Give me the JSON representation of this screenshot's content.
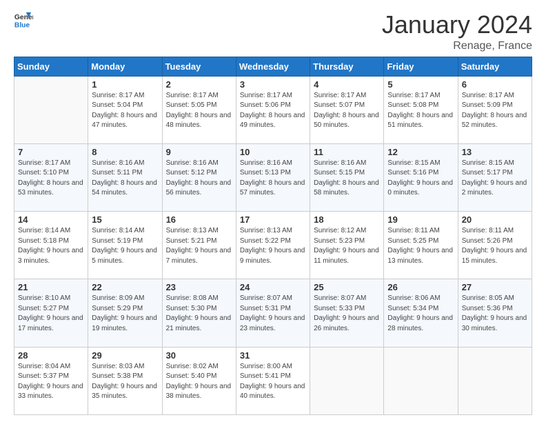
{
  "logo": {
    "line1": "General",
    "line2": "Blue"
  },
  "header": {
    "month": "January 2024",
    "location": "Renage, France"
  },
  "weekdays": [
    "Sunday",
    "Monday",
    "Tuesday",
    "Wednesday",
    "Thursday",
    "Friday",
    "Saturday"
  ],
  "weeks": [
    [
      {
        "day": "",
        "sunrise": "",
        "sunset": "",
        "daylight": ""
      },
      {
        "day": "1",
        "sunrise": "Sunrise: 8:17 AM",
        "sunset": "Sunset: 5:04 PM",
        "daylight": "Daylight: 8 hours and 47 minutes."
      },
      {
        "day": "2",
        "sunrise": "Sunrise: 8:17 AM",
        "sunset": "Sunset: 5:05 PM",
        "daylight": "Daylight: 8 hours and 48 minutes."
      },
      {
        "day": "3",
        "sunrise": "Sunrise: 8:17 AM",
        "sunset": "Sunset: 5:06 PM",
        "daylight": "Daylight: 8 hours and 49 minutes."
      },
      {
        "day": "4",
        "sunrise": "Sunrise: 8:17 AM",
        "sunset": "Sunset: 5:07 PM",
        "daylight": "Daylight: 8 hours and 50 minutes."
      },
      {
        "day": "5",
        "sunrise": "Sunrise: 8:17 AM",
        "sunset": "Sunset: 5:08 PM",
        "daylight": "Daylight: 8 hours and 51 minutes."
      },
      {
        "day": "6",
        "sunrise": "Sunrise: 8:17 AM",
        "sunset": "Sunset: 5:09 PM",
        "daylight": "Daylight: 8 hours and 52 minutes."
      }
    ],
    [
      {
        "day": "7",
        "sunrise": "Sunrise: 8:17 AM",
        "sunset": "Sunset: 5:10 PM",
        "daylight": "Daylight: 8 hours and 53 minutes."
      },
      {
        "day": "8",
        "sunrise": "Sunrise: 8:16 AM",
        "sunset": "Sunset: 5:11 PM",
        "daylight": "Daylight: 8 hours and 54 minutes."
      },
      {
        "day": "9",
        "sunrise": "Sunrise: 8:16 AM",
        "sunset": "Sunset: 5:12 PM",
        "daylight": "Daylight: 8 hours and 56 minutes."
      },
      {
        "day": "10",
        "sunrise": "Sunrise: 8:16 AM",
        "sunset": "Sunset: 5:13 PM",
        "daylight": "Daylight: 8 hours and 57 minutes."
      },
      {
        "day": "11",
        "sunrise": "Sunrise: 8:16 AM",
        "sunset": "Sunset: 5:15 PM",
        "daylight": "Daylight: 8 hours and 58 minutes."
      },
      {
        "day": "12",
        "sunrise": "Sunrise: 8:15 AM",
        "sunset": "Sunset: 5:16 PM",
        "daylight": "Daylight: 9 hours and 0 minutes."
      },
      {
        "day": "13",
        "sunrise": "Sunrise: 8:15 AM",
        "sunset": "Sunset: 5:17 PM",
        "daylight": "Daylight: 9 hours and 2 minutes."
      }
    ],
    [
      {
        "day": "14",
        "sunrise": "Sunrise: 8:14 AM",
        "sunset": "Sunset: 5:18 PM",
        "daylight": "Daylight: 9 hours and 3 minutes."
      },
      {
        "day": "15",
        "sunrise": "Sunrise: 8:14 AM",
        "sunset": "Sunset: 5:19 PM",
        "daylight": "Daylight: 9 hours and 5 minutes."
      },
      {
        "day": "16",
        "sunrise": "Sunrise: 8:13 AM",
        "sunset": "Sunset: 5:21 PM",
        "daylight": "Daylight: 9 hours and 7 minutes."
      },
      {
        "day": "17",
        "sunrise": "Sunrise: 8:13 AM",
        "sunset": "Sunset: 5:22 PM",
        "daylight": "Daylight: 9 hours and 9 minutes."
      },
      {
        "day": "18",
        "sunrise": "Sunrise: 8:12 AM",
        "sunset": "Sunset: 5:23 PM",
        "daylight": "Daylight: 9 hours and 11 minutes."
      },
      {
        "day": "19",
        "sunrise": "Sunrise: 8:11 AM",
        "sunset": "Sunset: 5:25 PM",
        "daylight": "Daylight: 9 hours and 13 minutes."
      },
      {
        "day": "20",
        "sunrise": "Sunrise: 8:11 AM",
        "sunset": "Sunset: 5:26 PM",
        "daylight": "Daylight: 9 hours and 15 minutes."
      }
    ],
    [
      {
        "day": "21",
        "sunrise": "Sunrise: 8:10 AM",
        "sunset": "Sunset: 5:27 PM",
        "daylight": "Daylight: 9 hours and 17 minutes."
      },
      {
        "day": "22",
        "sunrise": "Sunrise: 8:09 AM",
        "sunset": "Sunset: 5:29 PM",
        "daylight": "Daylight: 9 hours and 19 minutes."
      },
      {
        "day": "23",
        "sunrise": "Sunrise: 8:08 AM",
        "sunset": "Sunset: 5:30 PM",
        "daylight": "Daylight: 9 hours and 21 minutes."
      },
      {
        "day": "24",
        "sunrise": "Sunrise: 8:07 AM",
        "sunset": "Sunset: 5:31 PM",
        "daylight": "Daylight: 9 hours and 23 minutes."
      },
      {
        "day": "25",
        "sunrise": "Sunrise: 8:07 AM",
        "sunset": "Sunset: 5:33 PM",
        "daylight": "Daylight: 9 hours and 26 minutes."
      },
      {
        "day": "26",
        "sunrise": "Sunrise: 8:06 AM",
        "sunset": "Sunset: 5:34 PM",
        "daylight": "Daylight: 9 hours and 28 minutes."
      },
      {
        "day": "27",
        "sunrise": "Sunrise: 8:05 AM",
        "sunset": "Sunset: 5:36 PM",
        "daylight": "Daylight: 9 hours and 30 minutes."
      }
    ],
    [
      {
        "day": "28",
        "sunrise": "Sunrise: 8:04 AM",
        "sunset": "Sunset: 5:37 PM",
        "daylight": "Daylight: 9 hours and 33 minutes."
      },
      {
        "day": "29",
        "sunrise": "Sunrise: 8:03 AM",
        "sunset": "Sunset: 5:38 PM",
        "daylight": "Daylight: 9 hours and 35 minutes."
      },
      {
        "day": "30",
        "sunrise": "Sunrise: 8:02 AM",
        "sunset": "Sunset: 5:40 PM",
        "daylight": "Daylight: 9 hours and 38 minutes."
      },
      {
        "day": "31",
        "sunrise": "Sunrise: 8:00 AM",
        "sunset": "Sunset: 5:41 PM",
        "daylight": "Daylight: 9 hours and 40 minutes."
      },
      {
        "day": "",
        "sunrise": "",
        "sunset": "",
        "daylight": ""
      },
      {
        "day": "",
        "sunrise": "",
        "sunset": "",
        "daylight": ""
      },
      {
        "day": "",
        "sunrise": "",
        "sunset": "",
        "daylight": ""
      }
    ]
  ]
}
